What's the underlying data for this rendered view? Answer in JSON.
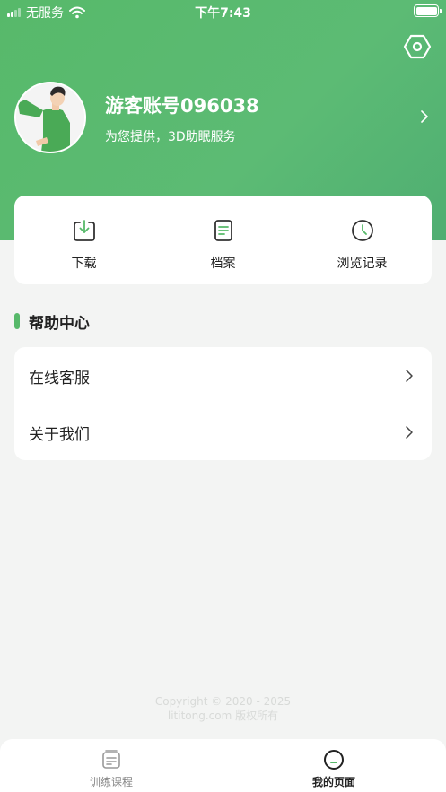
{
  "status_bar": {
    "carrier": "无服务",
    "time": "下午7:43"
  },
  "profile": {
    "username": "游客账号096038",
    "tagline": "为您提供，3D助眠服务"
  },
  "quick_actions": [
    {
      "label": "下载",
      "icon": "download-icon"
    },
    {
      "label": "档案",
      "icon": "document-icon"
    },
    {
      "label": "浏览记录",
      "icon": "clock-icon"
    }
  ],
  "help_center": {
    "title": "帮助中心",
    "items": [
      {
        "label": "在线客服"
      },
      {
        "label": "关于我们"
      }
    ]
  },
  "footer": {
    "copyright_line1": "Copyright © 2020 - 2025",
    "copyright_line2": "lititong.com 版权所有"
  },
  "tab_bar": {
    "tabs": [
      {
        "label": "训练课程",
        "icon": "course-icon",
        "active": false
      },
      {
        "label": "我的页面",
        "icon": "profile-face-icon",
        "active": true
      }
    ]
  },
  "colors": {
    "accent": "#57b96a",
    "background": "#f3f4f3"
  }
}
